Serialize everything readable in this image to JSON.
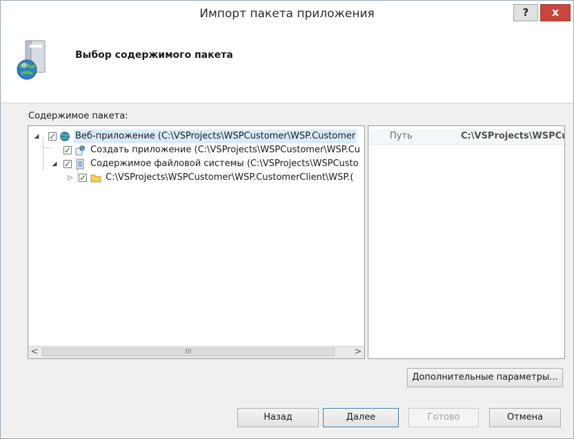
{
  "window": {
    "title": "Импорт пакета приложения",
    "help_label": "?",
    "close_label": "x"
  },
  "header": {
    "title": "Выбор содержимого пакета",
    "icon": "package-globe-icon"
  },
  "content": {
    "label": "Содержимое пакета:",
    "tree": [
      {
        "label": "Веб-приложение (C:\\VSProjects\\WSPCustomer\\WSP.Customer",
        "icon": "globe-icon",
        "checked": true,
        "expanded": true
      },
      {
        "label": "Создать приложение (C:\\VSProjects\\WSPCustomer\\WSP.Cu",
        "icon": "create-app-icon",
        "checked": true
      },
      {
        "label": "Содержимое файловой системы (C:\\VSProjects\\WSPCusto",
        "icon": "file-system-icon",
        "checked": true,
        "expanded": true
      },
      {
        "label": "C:\\VSProjects\\WSPCustomer\\WSP.CustomerClient\\WSP.(",
        "icon": "folder-icon",
        "checked": true,
        "expanded": false
      }
    ],
    "scroll_thumb": "III",
    "scroll_left": "<",
    "scroll_right": ">"
  },
  "properties": {
    "rows": [
      {
        "name": "Путь",
        "value": "C:\\VSProjects\\WSPCu"
      }
    ]
  },
  "buttons": {
    "advanced": "Дополнительные параметры...",
    "back": "Назад",
    "next": "Далее",
    "finish": "Готово",
    "cancel": "Отмена"
  }
}
